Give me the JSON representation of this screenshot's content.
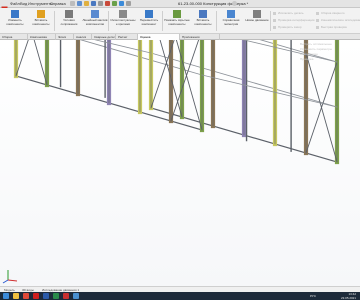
{
  "app": {
    "name": "SOLIDWORKS",
    "document_title": "61-23-00-000 Конструкция фахверка *"
  },
  "menu": {
    "items": [
      "Файл",
      "Вид",
      "Инструменты",
      "Справка"
    ]
  },
  "ribbon": {
    "buttons": [
      {
        "label": "Изменить компоненты",
        "icon": "edit-component-icon",
        "color": "#3a78c8"
      },
      {
        "label": "Вставить компоненты",
        "icon": "insert-component-icon",
        "color": "#e0a020"
      },
      {
        "label": "Условия сопряжения",
        "icon": "mate-icon",
        "color": "#7a7a7a"
      },
      {
        "label": "Линейный массив компонентов",
        "icon": "linear-pattern-icon",
        "color": "#5a8ad0"
      },
      {
        "label": "Интеллектуальные крепежи",
        "icon": "smart-fasteners-icon",
        "color": "#888888"
      },
      {
        "label": "Переместить компонент",
        "icon": "move-component-icon",
        "color": "#3a7ac8"
      },
      {
        "label": "Показать скрытые компоненты",
        "icon": "show-hidden-icon",
        "color": "#6a9a40"
      },
      {
        "label": "Вставить компоненты",
        "icon": "insert-icon-2",
        "color": "#4a78c0"
      },
      {
        "label": "Справочная геометрия",
        "icon": "reference-geometry-icon",
        "color": "#4a86d0"
      },
      {
        "label": "Новое движение",
        "icon": "new-motion-icon",
        "color": "#7f7f7f"
      }
    ],
    "disabled_items": [
      "Исключить деталь",
      "Проверка интерференции",
      "Проверить зазор",
      "Сборка сварного",
      "Кинематическое исследование",
      "Быстрая проверка"
    ]
  },
  "tabs": [
    {
      "label": "Сборка",
      "active": false
    },
    {
      "label": "Компоновка",
      "active": false
    },
    {
      "label": "Эскиз",
      "active": false
    },
    {
      "label": "Анализ",
      "active": false
    },
    {
      "label": "Сварные детали",
      "active": false
    },
    {
      "label": "Расчет",
      "active": false
    },
    {
      "label": "Оценка",
      "active": true
    },
    {
      "label": "Приложения",
      "active": false
    }
  ],
  "viewport": {
    "hint_lines": [
      "Выбрать оптимальные",
      "Установить параметры",
      "Найти далее",
      "Проверка"
    ]
  },
  "model_tabs": [
    "Модель",
    "3D виды",
    "Исследование движения 1"
  ],
  "taskbar": {
    "icons": [
      {
        "name": "start-icon",
        "color": "#3c8bd9"
      },
      {
        "name": "explorer-icon",
        "color": "#f0c040"
      },
      {
        "name": "browser-icon",
        "color": "#e04a3a"
      },
      {
        "name": "solidworks-icon",
        "color": "#d02020"
      },
      {
        "name": "word-icon",
        "color": "#2b5aa8"
      },
      {
        "name": "excel-icon",
        "color": "#2a8a4a"
      },
      {
        "name": "pdf-icon",
        "color": "#c83030"
      },
      {
        "name": "mail-icon",
        "color": "#4a90d0"
      }
    ],
    "language": "РУС",
    "time": "13:42",
    "date": "23.05.2021"
  },
  "colors": {
    "steel": "#8d9299",
    "steel_dark": "#5b6068",
    "column_yellow": "#c7c860",
    "column_green": "#7ea14a",
    "column_brown": "#8b7656",
    "column_purple": "#8f84b4"
  }
}
